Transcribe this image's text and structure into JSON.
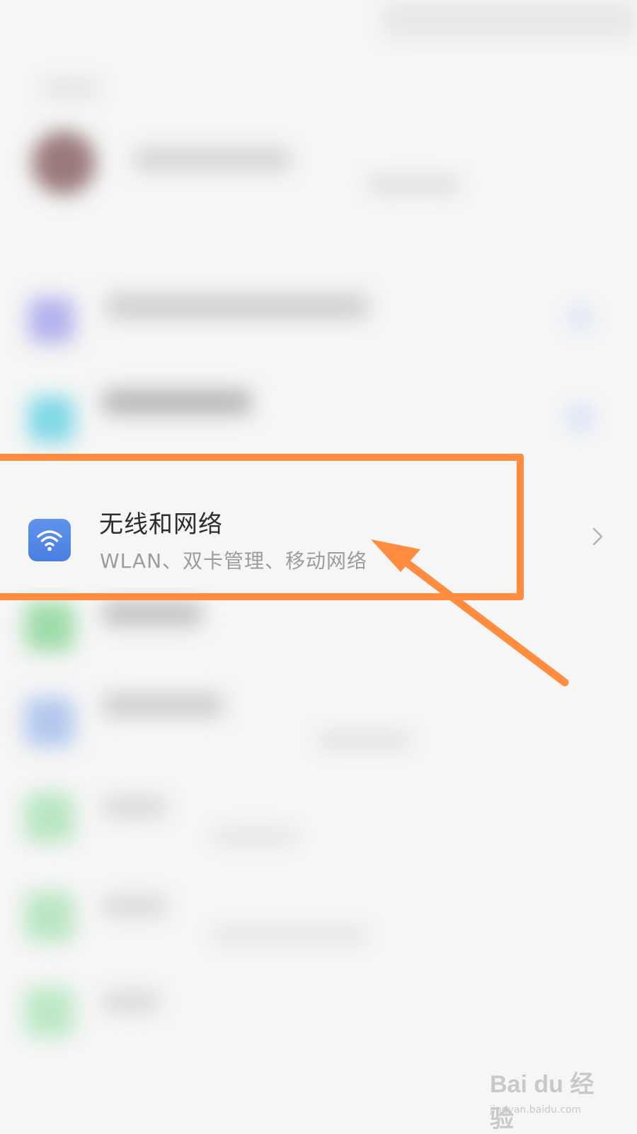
{
  "menu_item": {
    "title": "无线和网络",
    "subtitle": "WLAN、双卡管理、移动网络",
    "icon": "wifi-icon",
    "icon_color": "#4a7fe2"
  },
  "annotation": {
    "color": "#ff8c3f"
  },
  "watermark": {
    "brand": "Bai du 经验",
    "url": "jingyan.baidu.com"
  }
}
